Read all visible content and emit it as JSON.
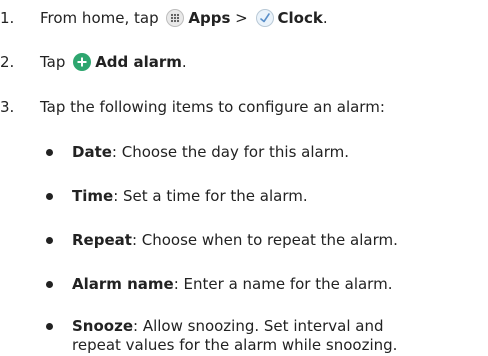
{
  "steps": [
    {
      "number": "1.",
      "prefix": "From home, tap",
      "apps_label": "Apps",
      "separator": ">",
      "clock_label": "Clock",
      "suffix": "."
    },
    {
      "number": "2.",
      "prefix": "Tap",
      "action_label": "Add alarm",
      "suffix": "."
    },
    {
      "number": "3.",
      "text": "Tap the following items to configure an alarm:"
    }
  ],
  "options": [
    {
      "term": "Date",
      "desc": ": Choose the day for this alarm."
    },
    {
      "term": "Time",
      "desc": ": Set a time for the alarm."
    },
    {
      "term": "Repeat",
      "desc": ": Choose when to repeat the alarm."
    },
    {
      "term": "Alarm name",
      "desc": ": Enter a name for the alarm."
    },
    {
      "term": "Snooze",
      "desc": ": Allow snoozing. Set interval and",
      "desc_cont": "repeat values for the alarm while snoozing."
    }
  ],
  "icons": {
    "apps": "apps-grid-icon",
    "clock": "clock-icon",
    "add": "add-icon"
  },
  "colors": {
    "text": "#222222",
    "add_icon": "#2ea66f",
    "apps_icon_bg": "#e9e9e9",
    "clock_icon_bg": "#eaf3fb"
  }
}
